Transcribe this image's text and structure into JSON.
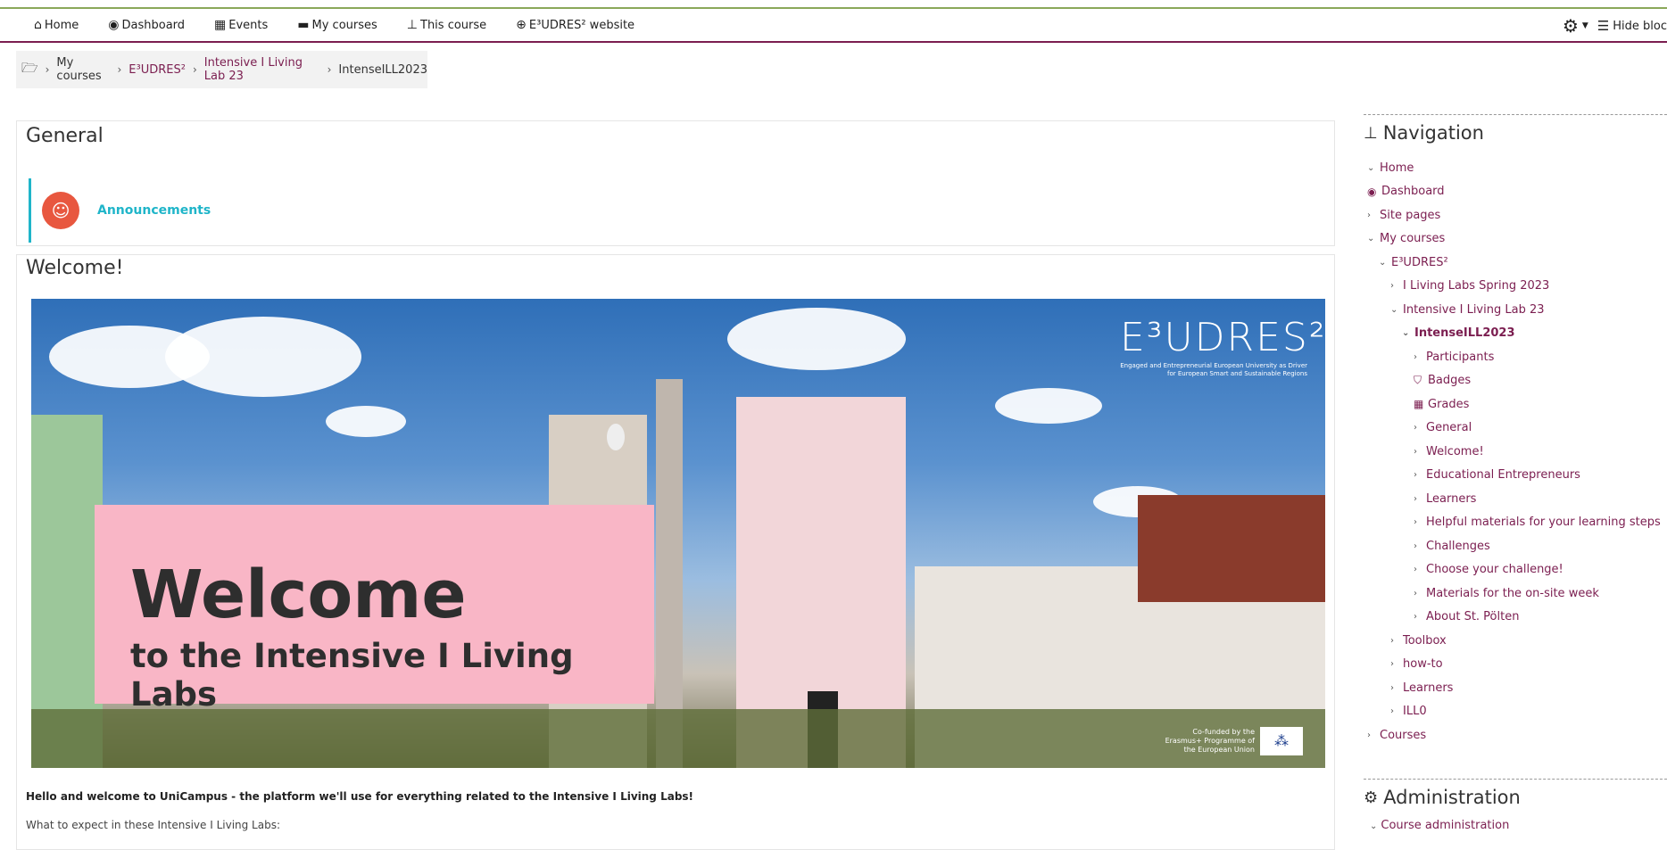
{
  "topnav": {
    "items": [
      {
        "label": "Home",
        "icon": "home-icon"
      },
      {
        "label": "Dashboard",
        "icon": "dashboard-icon"
      },
      {
        "label": "Events",
        "icon": "calendar-icon"
      },
      {
        "label": "My courses",
        "icon": "briefcase-icon"
      },
      {
        "label": "This course",
        "icon": "sitemap-icon"
      },
      {
        "label": "E³UDRES² website",
        "icon": "lifebuoy-icon"
      }
    ],
    "hide_blocks": "Hide bloc"
  },
  "breadcrumb": {
    "items": [
      "My courses",
      "E³UDRES²",
      "Intensive I Living Lab 23",
      "IntenseILL2023"
    ]
  },
  "sections": {
    "general": {
      "title": "General",
      "announcements": "Announcements"
    },
    "welcome": {
      "title": "Welcome!",
      "banner_big": "Welcome",
      "banner_sub": "to the Intensive I Living Labs",
      "logo_text": "E³UDRES²",
      "logo_sub": "Engaged and Entrepreneurial European University as Driver for European Smart and Sustainable Regions",
      "eu_text": "Co-funded by the Erasmus+ Programme of the European Union",
      "intro": "Hello and welcome to UniCampus - the platform we'll use for everything related to the Intensive I Living Labs!",
      "expect": "What to expect in these Intensive I Living Labs:"
    }
  },
  "navigation": {
    "title": "Navigation",
    "items": [
      {
        "label": "Home",
        "chev": "⌄",
        "indent": 0
      },
      {
        "label": "Dashboard",
        "chev": "",
        "icon": "dashboard-icon",
        "indent": 0
      },
      {
        "label": "Site pages",
        "chev": "›",
        "indent": 0
      },
      {
        "label": "My courses",
        "chev": "⌄",
        "indent": 0
      },
      {
        "label": "E³UDRES²",
        "chev": "⌄",
        "indent": 1
      },
      {
        "label": "I Living Labs Spring 2023",
        "chev": "›",
        "indent": 2
      },
      {
        "label": "Intensive I Living Lab 23",
        "chev": "⌄",
        "indent": 2
      },
      {
        "label": "IntenseILL2023",
        "chev": "⌄",
        "indent": 3,
        "bold": true
      },
      {
        "label": "Participants",
        "chev": "›",
        "indent": 4
      },
      {
        "label": "Badges",
        "chev": "",
        "icon": "shield-icon",
        "indent": 4
      },
      {
        "label": "Grades",
        "chev": "",
        "icon": "table-icon",
        "indent": 4
      },
      {
        "label": "General",
        "chev": "›",
        "indent": 4
      },
      {
        "label": "Welcome!",
        "chev": "›",
        "indent": 4
      },
      {
        "label": "Educational Entrepreneurs",
        "chev": "›",
        "indent": 4
      },
      {
        "label": "Learners",
        "chev": "›",
        "indent": 4
      },
      {
        "label": "Helpful materials for your learning steps",
        "chev": "›",
        "indent": 4
      },
      {
        "label": "Challenges",
        "chev": "›",
        "indent": 4
      },
      {
        "label": "Choose your challenge!",
        "chev": "›",
        "indent": 4
      },
      {
        "label": "Materials for the on-site week",
        "chev": "›",
        "indent": 4
      },
      {
        "label": "About St. Pölten",
        "chev": "›",
        "indent": 4
      },
      {
        "label": "Toolbox",
        "chev": "›",
        "indent": 2
      },
      {
        "label": "how-to",
        "chev": "›",
        "indent": 2
      },
      {
        "label": "Learners",
        "chev": "›",
        "indent": 2
      },
      {
        "label": "ILL0",
        "chev": "›",
        "indent": 2
      },
      {
        "label": "Courses",
        "chev": "›",
        "indent": 0
      }
    ]
  },
  "administration": {
    "title": "Administration",
    "items": [
      "Course administration"
    ]
  },
  "colors": {
    "accent": "#7b1e50",
    "teal": "#1fb5c9",
    "announce_icon": "#e8573f"
  }
}
